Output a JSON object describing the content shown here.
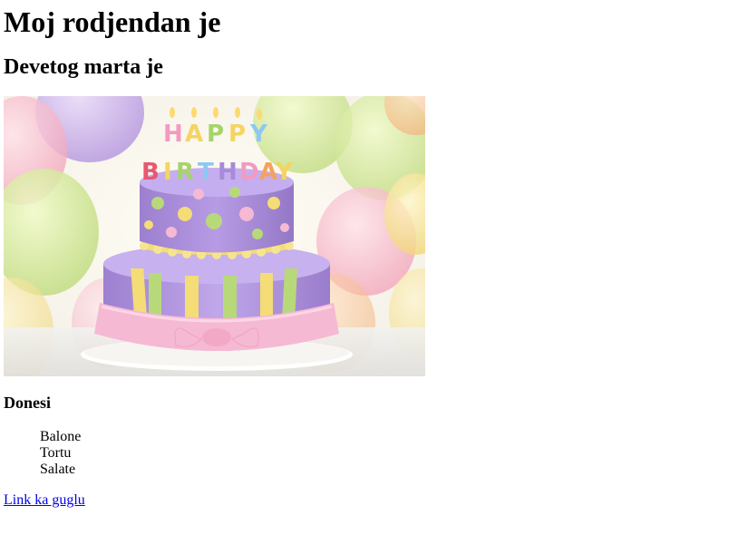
{
  "page": {
    "title": "Moj rodjendan je",
    "subtitle": "Devetog marta je",
    "image": {
      "candle_letters_top": "HAPPY",
      "candle_letters_bottom": "BIRTHDAY"
    },
    "bring_heading": "Donesi",
    "bring_items": [
      "Balone",
      "Tortu",
      "Salate"
    ],
    "link_label": "Link ka guglu"
  },
  "colors": {
    "link": "#0000ee",
    "text": "#000000",
    "background": "#ffffff",
    "cake_purple": "#a98bd6",
    "cake_pink": "#f6b9d3",
    "ribbon_yellow": "#f4dc76",
    "ribbon_green": "#b8d97a"
  }
}
